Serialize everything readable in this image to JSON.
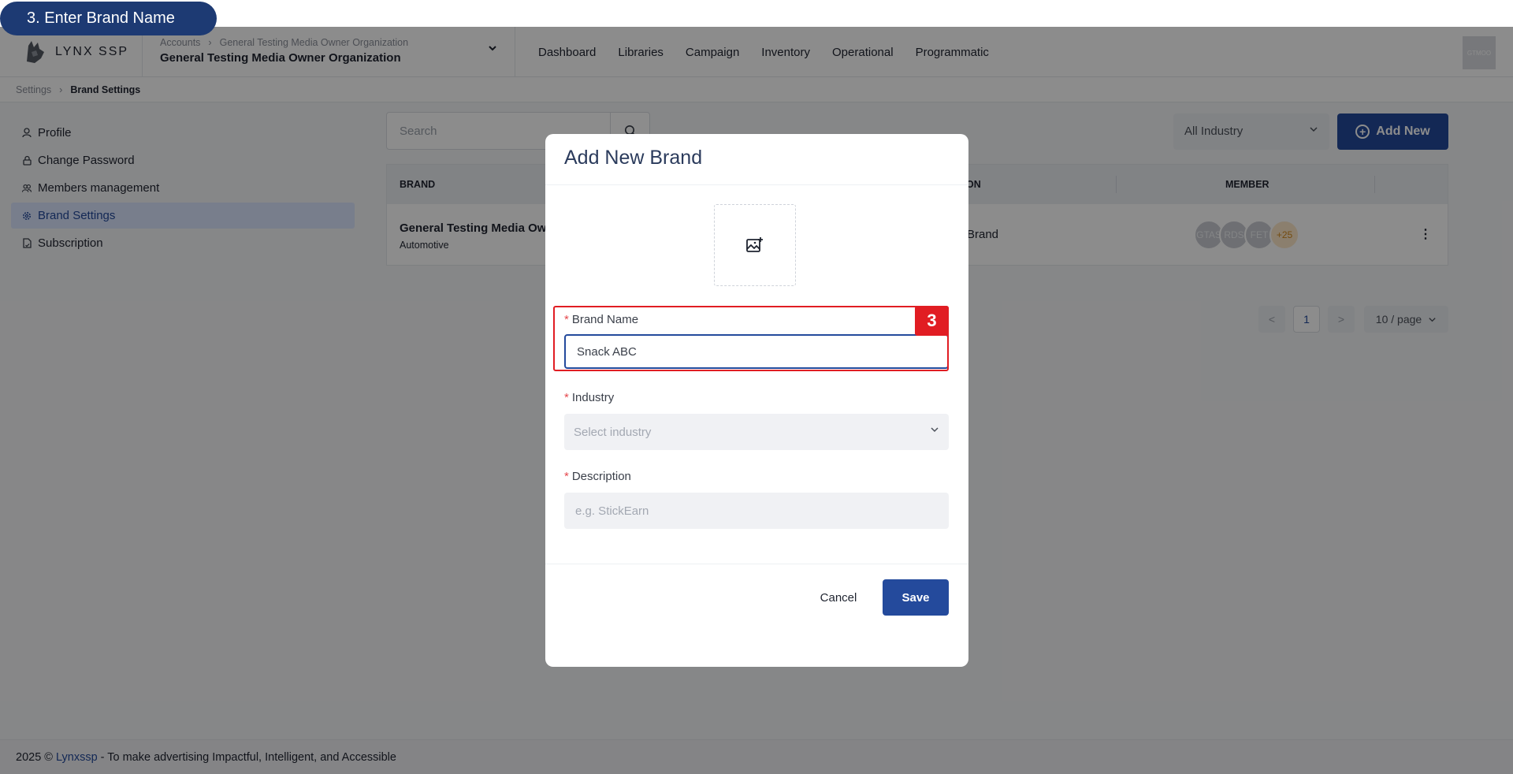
{
  "step_banner": "3. Enter Brand Name",
  "header": {
    "logo_text": "LYNX SSP",
    "account_crumb": [
      "Accounts",
      "General Testing Media Owner Organization"
    ],
    "organization": "General Testing Media Owner Organization",
    "nav": [
      "Dashboard",
      "Libraries",
      "Campaign",
      "Inventory",
      "Operational",
      "Programmatic"
    ],
    "avatar_text": "GTMOO"
  },
  "breadcrumb": {
    "parent": "Settings",
    "current": "Brand Settings"
  },
  "sidebar": {
    "items": [
      {
        "label": "Profile",
        "icon": "user-icon",
        "active": false
      },
      {
        "label": "Change Password",
        "icon": "lock-icon",
        "active": false
      },
      {
        "label": "Members management",
        "icon": "users-icon",
        "active": false
      },
      {
        "label": "Brand Settings",
        "icon": "gear-icon",
        "active": true
      },
      {
        "label": "Subscription",
        "icon": "document-icon",
        "active": false
      }
    ]
  },
  "toolbar": {
    "search_placeholder": "Search",
    "industry_filter": "All Industry",
    "add_new_label": "Add New"
  },
  "table": {
    "headers": [
      "BRAND",
      "ON",
      "MEMBER"
    ],
    "rows": [
      {
        "brand_name": "General Testing Media Ow",
        "industry": "Automotive",
        "description": "Brand",
        "members": [
          "GTAS",
          "RDS",
          "FET"
        ],
        "member_extra": "+25"
      }
    ]
  },
  "pagination": {
    "prev": "<",
    "current": "1",
    "next": ">",
    "page_size": "10 / page"
  },
  "footer": {
    "prefix": "2025 ©",
    "brand": "Lynxssp",
    "suffix": "- To make advertising Impactful, Intelligent, and Accessible"
  },
  "modal": {
    "title": "Add New Brand",
    "brand_name_label": "Brand Name",
    "brand_name_value": "Snack ABC",
    "industry_label": "Industry",
    "industry_placeholder": "Select industry",
    "description_label": "Description",
    "description_placeholder": "e.g. StickEarn",
    "required_mark": "*",
    "cancel_label": "Cancel",
    "save_label": "Save",
    "step_number": "3"
  },
  "colors": {
    "primary": "#244a9c",
    "highlight": "#e11d23",
    "banner": "#1d3a73"
  }
}
